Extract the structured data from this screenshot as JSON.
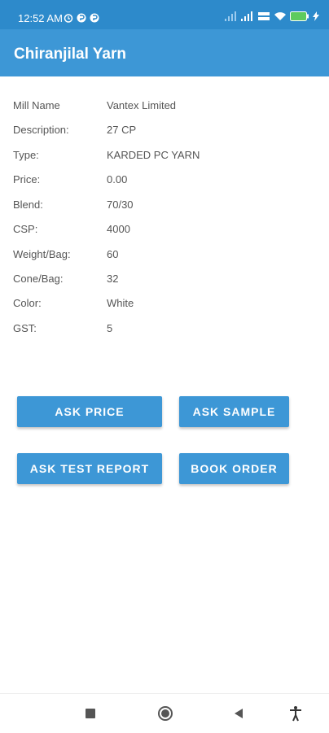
{
  "status_bar": {
    "time": "12:52 AM",
    "battery": "84"
  },
  "app_bar": {
    "title": "Chiranjilal Yarn"
  },
  "details": [
    {
      "label": "Mill Name",
      "value": "Vantex Limited"
    },
    {
      "label": "Description:",
      "value": "27 CP"
    },
    {
      "label": "Type:",
      "value": "KARDED PC YARN"
    },
    {
      "label": "Price:",
      "value": "0.00"
    },
    {
      "label": "Blend:",
      "value": "70/30"
    },
    {
      "label": "CSP:",
      "value": "4000"
    },
    {
      "label": "Weight/Bag:",
      "value": "60"
    },
    {
      "label": "Cone/Bag:",
      "value": "32"
    },
    {
      "label": "Color:",
      "value": "White"
    },
    {
      "label": "GST:",
      "value": "5"
    }
  ],
  "buttons": {
    "ask_price": "ASK PRICE",
    "ask_sample": "ASK SAMPLE",
    "ask_test_report": "ASK TEST REPORT",
    "book_order": "BOOK ORDER"
  },
  "nav": {
    "icons": [
      "square-icon",
      "circle-icon",
      "back-triangle-icon",
      "accessibility-icon"
    ]
  },
  "colors": {
    "status_bar": "#2d8acb",
    "app_bar": "#3d97d6",
    "button": "#3d97d6",
    "text": "#555555"
  }
}
